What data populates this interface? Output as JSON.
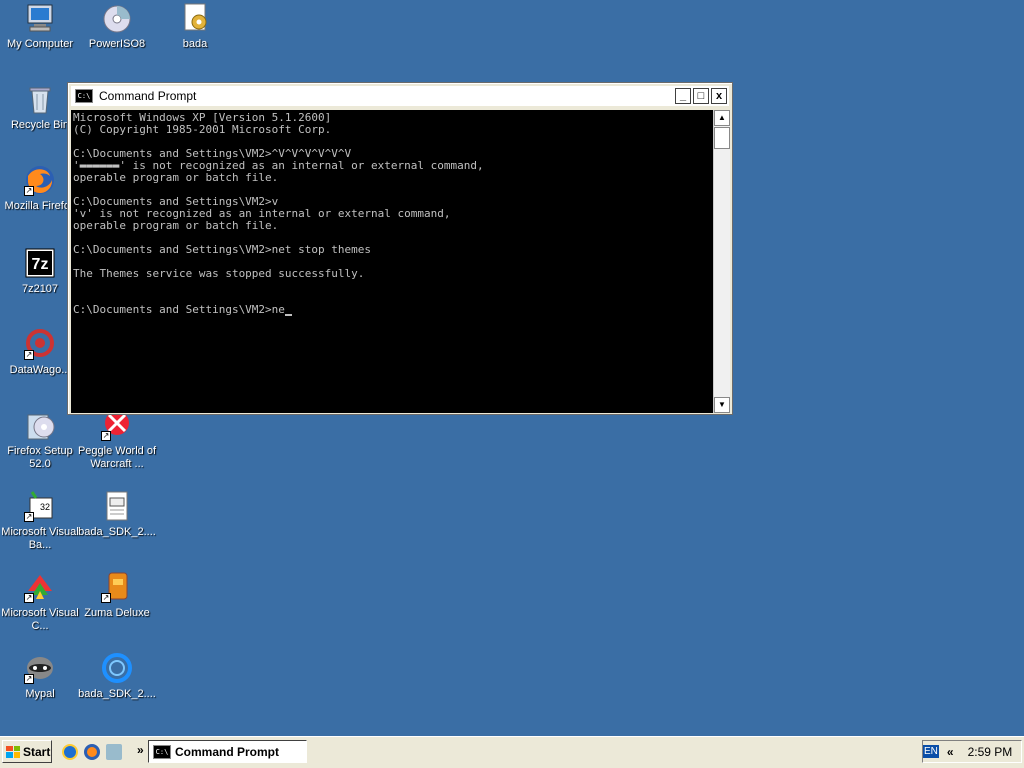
{
  "desktop": {
    "icons": [
      {
        "label": "My Computer"
      },
      {
        "label": "PowerISO8"
      },
      {
        "label": "bada"
      },
      {
        "label": "Recycle Bin"
      },
      {
        "label": "Mozilla Firefox"
      },
      {
        "label": "7z2107"
      },
      {
        "label": "DataWago..."
      },
      {
        "label": "Firefox Setup 52.0"
      },
      {
        "label": "Peggle World of Warcraft ..."
      },
      {
        "label": "Microsoft Visual Ba..."
      },
      {
        "label": "bada_SDK_2...."
      },
      {
        "label": "Microsoft Visual C..."
      },
      {
        "label": "Zuma Deluxe"
      },
      {
        "label": "Mypal"
      },
      {
        "label": "bada_SDK_2...."
      }
    ]
  },
  "cmd": {
    "title": "Command Prompt",
    "minimize": "_",
    "maximize": "□",
    "close": "x",
    "console_text": "Microsoft Windows XP [Version 5.1.2600]\n(C) Copyright 1985-2001 Microsoft Corp.\n\nC:\\Documents and Settings\\VM2>^V^V^V^V^V^V\n'▬▬▬▬▬▬' is not recognized as an internal or external command,\noperable program or batch file.\n\nC:\\Documents and Settings\\VM2>v\n'v' is not recognized as an internal or external command,\noperable program or batch file.\n\nC:\\Documents and Settings\\VM2>net stop themes\n\nThe Themes service was stopped successfully.\n\n\nC:\\Documents and Settings\\VM2>ne",
    "scroll_up": "▲",
    "scroll_down": "▼"
  },
  "taskbar": {
    "start_label": "Start",
    "quicklaunch_chevron": "»",
    "task_label": "Command Prompt",
    "lang": "EN",
    "tray_chevron": "«",
    "clock": "2:59 PM"
  }
}
